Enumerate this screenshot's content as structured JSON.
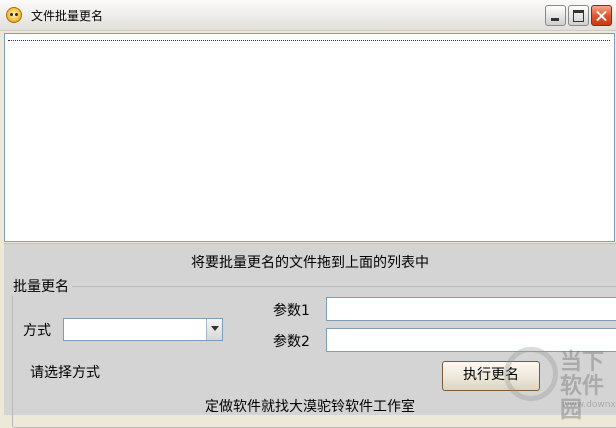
{
  "window": {
    "title": "文件批量更名"
  },
  "drop_hint": "将要批量更名的文件拖到上面的列表中",
  "group": {
    "legend": "批量更名"
  },
  "mode": {
    "label": "方式",
    "value": "",
    "status": "请选择方式"
  },
  "params": {
    "param1_label": "参数1",
    "param1_value": "",
    "param2_label": "参数2",
    "param2_value": ""
  },
  "execute_label": "执行更名",
  "footer": "定做软件就找大漠驼铃软件工作室",
  "watermark": {
    "text": "当下软件园",
    "sub": "www.downxia.com"
  },
  "colors": {
    "close_button": "#d9532f",
    "list_border": "#7f9db9"
  }
}
